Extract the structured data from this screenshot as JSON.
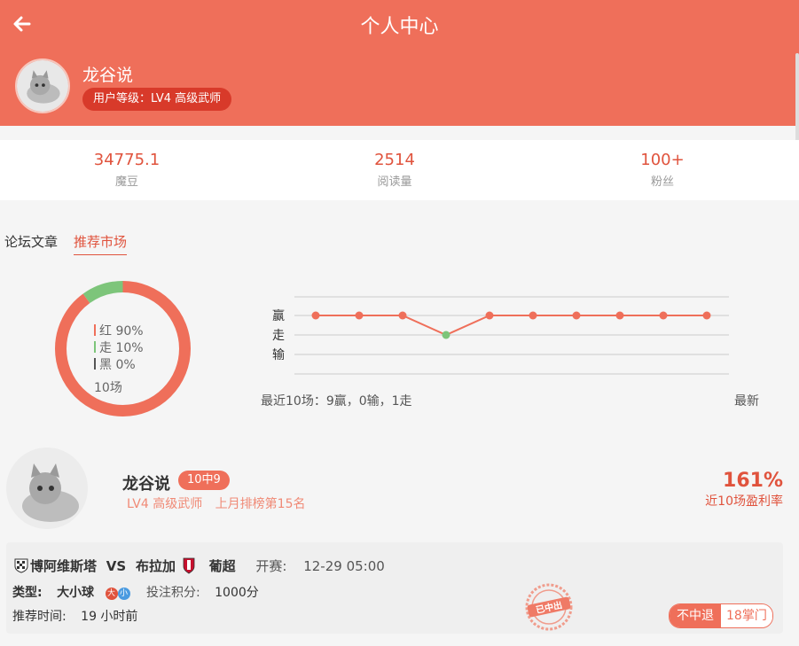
{
  "header": {
    "title": "个人中心",
    "back_icon": "arrow-left-icon"
  },
  "profile": {
    "name": "龙谷说",
    "level": "用户等级：LV4 高级武师"
  },
  "stats": [
    {
      "value": "34775.1",
      "label": "魔豆"
    },
    {
      "value": "2514",
      "label": "阅读量"
    },
    {
      "value": "100+",
      "label": "粉丝"
    }
  ],
  "tabs": [
    {
      "label": "论坛文章",
      "active": false
    },
    {
      "label": "推荐市场",
      "active": true
    }
  ],
  "summary": {
    "legend": [
      {
        "text": "红 90%",
        "color": "#ef6f5a",
        "fraction": 0.9
      },
      {
        "text": "走 10%",
        "color": "#7dc57a",
        "fraction": 0.1
      },
      {
        "text": "黑 0%",
        "color": "#555555",
        "fraction": 0
      }
    ],
    "count": "10场"
  },
  "chart_data": {
    "type": "line",
    "y_categories": [
      "赢",
      "走",
      "输"
    ],
    "values": [
      "赢",
      "赢",
      "赢",
      "走",
      "赢",
      "赢",
      "赢",
      "赢",
      "赢",
      "赢"
    ],
    "footer": "最近10场：9赢，0输，1走",
    "newest_label": "最新",
    "line_color": "#ef6f5a",
    "draw_color": "#7dc57a"
  },
  "expert": {
    "name": "龙谷说",
    "badge": "10中9",
    "level": "LV4 高级武师",
    "rank": "上月排榜第15名",
    "rate": "161%",
    "rate_label": "近10场盈利率"
  },
  "recommendation": {
    "home_team": "博阿维斯塔",
    "vs": "VS",
    "away_team": "布拉加",
    "league": "葡超",
    "kickoff_label": "开赛:",
    "kickoff": "12-29 05:00",
    "type_label": "类型:",
    "type_value": "大小球",
    "ou_big": "大",
    "ou_small": "小",
    "points_label": "投注积分:",
    "points_value": "1000分",
    "time_label": "推荐时间:",
    "time_value": "19 小时前",
    "stamp_text": "已中出",
    "refund_label": "不中退",
    "price_label": "18掌门"
  }
}
